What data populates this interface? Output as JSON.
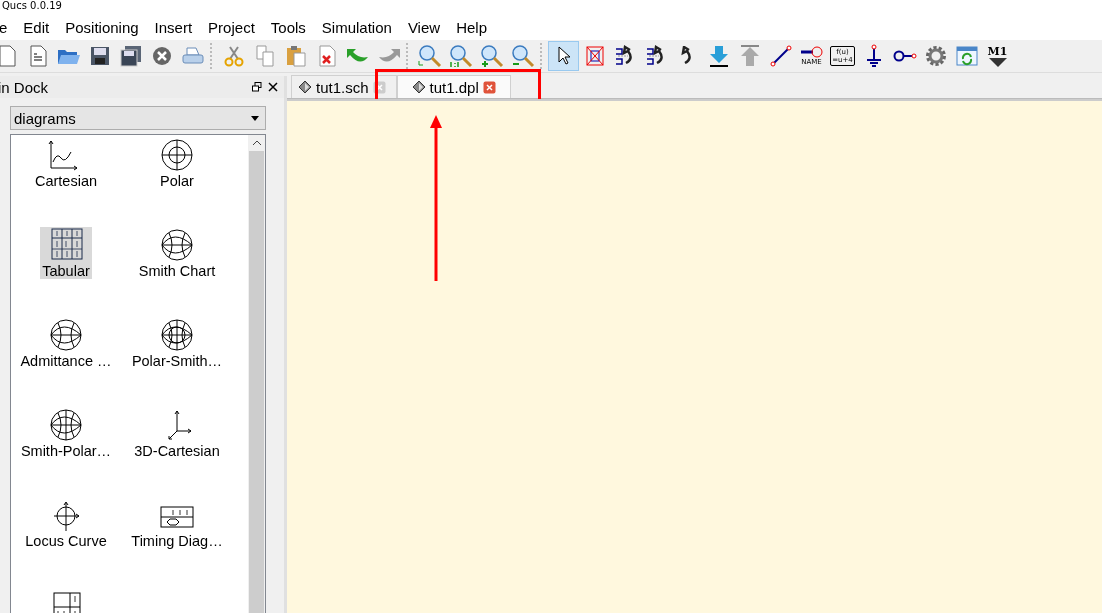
{
  "window": {
    "title": "Qucs 0.0.19"
  },
  "menu": [
    "e",
    "Edit",
    "Positioning",
    "Insert",
    "Project",
    "Tools",
    "Simulation",
    "View",
    "Help"
  ],
  "toolbar": [
    {
      "kind": "new",
      "selected": false
    },
    {
      "kind": "new-text",
      "selected": false
    },
    {
      "kind": "open",
      "selected": false
    },
    {
      "kind": "save",
      "selected": false
    },
    {
      "kind": "save-all",
      "selected": false
    },
    {
      "kind": "close",
      "selected": false
    },
    {
      "kind": "print",
      "selected": false
    },
    {
      "kind": "sep"
    },
    {
      "kind": "cut",
      "selected": false
    },
    {
      "kind": "copy",
      "selected": false
    },
    {
      "kind": "paste",
      "selected": false
    },
    {
      "kind": "delete",
      "selected": false
    },
    {
      "kind": "undo",
      "selected": false
    },
    {
      "kind": "redo",
      "selected": false
    },
    {
      "kind": "sep"
    },
    {
      "kind": "zoom-fit",
      "selected": false
    },
    {
      "kind": "zoom-one",
      "selected": false
    },
    {
      "kind": "zoom-in",
      "selected": false
    },
    {
      "kind": "zoom-out",
      "selected": false
    },
    {
      "kind": "sep"
    },
    {
      "kind": "pointer",
      "selected": true
    },
    {
      "kind": "deactivate",
      "selected": false
    },
    {
      "kind": "mirror-x",
      "selected": false
    },
    {
      "kind": "mirror-y",
      "selected": false
    },
    {
      "kind": "rotate",
      "selected": false
    },
    {
      "kind": "enter",
      "selected": false
    },
    {
      "kind": "exit",
      "selected": false
    },
    {
      "kind": "wire",
      "selected": false
    },
    {
      "kind": "label",
      "text": "NAME",
      "selected": false
    },
    {
      "kind": "equation",
      "text": "f(u)",
      "text2": "=u+4",
      "selected": false
    },
    {
      "kind": "ground",
      "selected": false
    },
    {
      "kind": "port",
      "selected": false
    },
    {
      "kind": "gear",
      "selected": false
    },
    {
      "kind": "window",
      "selected": false
    },
    {
      "kind": "marker",
      "text": "M1",
      "selected": false
    }
  ],
  "dock": {
    "title": "in Dock",
    "category": "diagrams",
    "items": [
      {
        "kind": "cartesian",
        "label": "Cartesian",
        "selected": false
      },
      {
        "kind": "polar",
        "label": "Polar",
        "selected": false
      },
      {
        "kind": "tabular",
        "label": "Tabular",
        "selected": true
      },
      {
        "kind": "smith",
        "label": "Smith Chart",
        "selected": false
      },
      {
        "kind": "admittance",
        "label": "Admittance …",
        "selected": false
      },
      {
        "kind": "polarsmith",
        "label": "Polar-Smith…",
        "selected": false
      },
      {
        "kind": "smithpolar",
        "label": "Smith-Polar…",
        "selected": false
      },
      {
        "kind": "cartesian3d",
        "label": "3D-Cartesian",
        "selected": false
      },
      {
        "kind": "locus",
        "label": "Locus Curve",
        "selected": false
      },
      {
        "kind": "timing",
        "label": "Timing Diag…",
        "selected": false
      },
      {
        "kind": "truth",
        "selected": false
      }
    ]
  },
  "tabs": [
    {
      "label": "tut1.sch",
      "selected": false,
      "highlighted": false
    },
    {
      "label": "tut1.dpl",
      "selected": true,
      "highlighted": true
    }
  ]
}
